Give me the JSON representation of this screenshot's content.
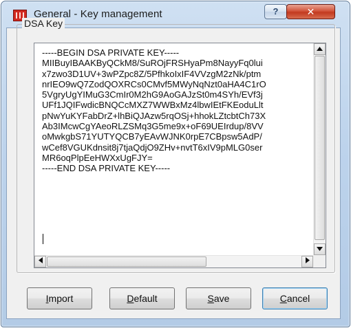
{
  "window": {
    "title": "General - Key management",
    "help_symbol": "?",
    "close_symbol": "✕"
  },
  "group": {
    "legend": "DSA Key"
  },
  "key_text": {
    "lines": [
      "-----BEGIN DSA PRIVATE KEY-----",
      "MIIBuyIBAAKByQCkM8/SuROjFRSHyaPm8NayyFq0lui",
      "x7zwo3D1UV+3wPZpc8Z/5PfhkoIxIF4VVzgM2zNk/ptm",
      "nrIEO9wQ7ZodQOXRCs0CMvf5MWyNqNzt0aHA4C1rO",
      "5VgryUgYIMuG3CmIr0M2hG9AoGAJzSt0m4SYh/EVf3j",
      "UFf1JQIFwdicBNQCcMXZ7WWBxMz4lbwIEtFKEoduLlt",
      "pNwYuKYFabDrZ+lhBiQJAzw5rqOSj+hhokLZtcbtCh73X",
      "Ab3IMcwCgYAeoRLZSMq3G5me9x+oF69UEIrdup/8VV",
      "oMwkgbS71YUTYQCB7yEAvWJNK0rpE7CBpsw5AdP/",
      "wCef8VGUKdnsit8j7tjaQdjO9ZHv+nvtT6xIV9pMLG0ser",
      "MR6oqPlpEeHWXxUgFJY=",
      "-----END DSA PRIVATE KEY-----"
    ]
  },
  "buttons": {
    "import": {
      "pre": "",
      "accel": "I",
      "post": "mport"
    },
    "default": {
      "pre": "",
      "accel": "D",
      "post": "efault"
    },
    "save": {
      "pre": "",
      "accel": "S",
      "post": "ave"
    },
    "cancel": {
      "pre": "",
      "accel": "C",
      "post": "ancel"
    }
  },
  "colors": {
    "titlebar": "#c4d8ee",
    "close_button": "#c7412a",
    "app_icon": "#d0281f",
    "dialog_background": "#f0f0f0"
  },
  "icons": {
    "app": "app-icon",
    "help": "help-icon",
    "close": "close-icon"
  }
}
